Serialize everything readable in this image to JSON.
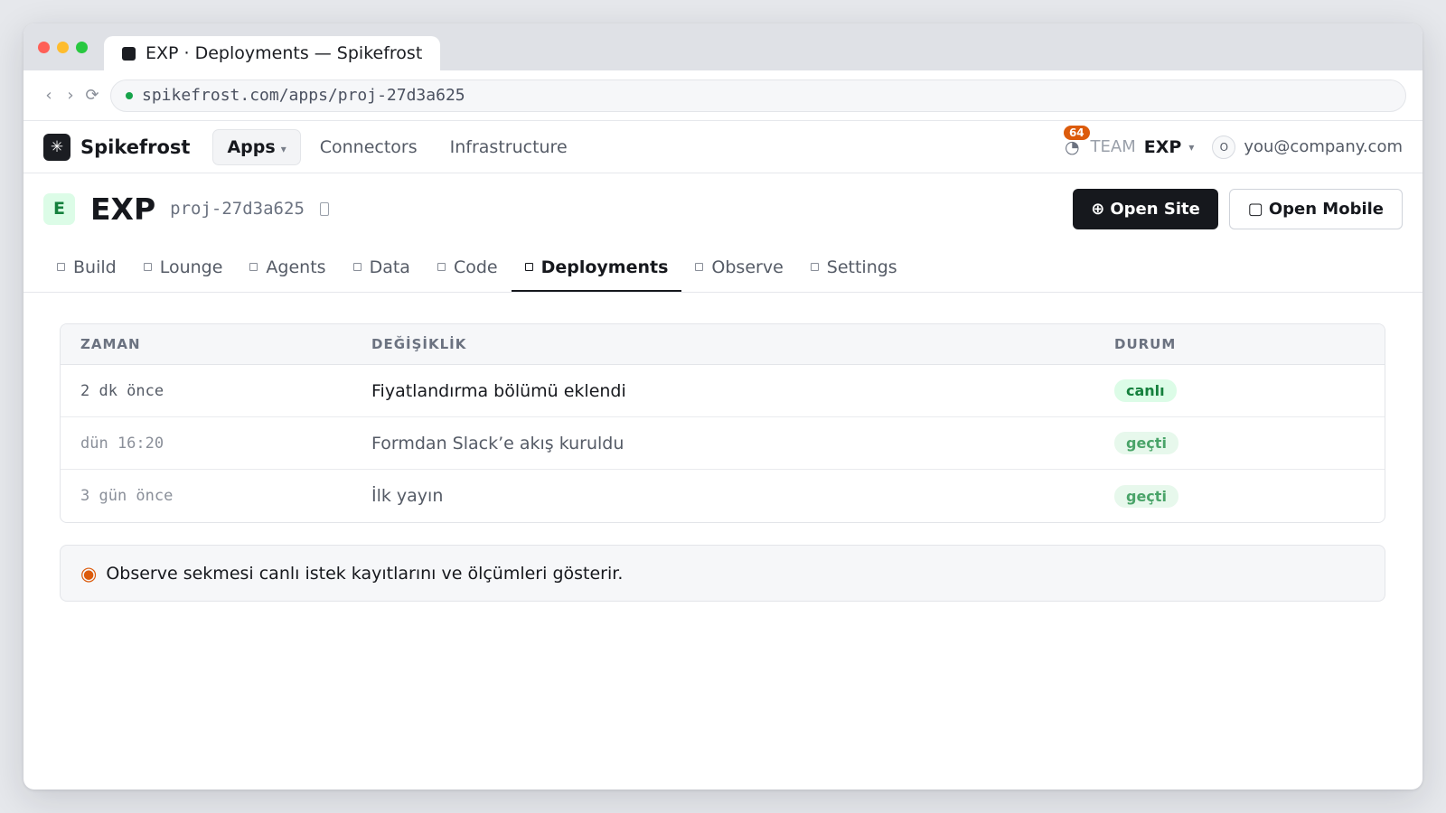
{
  "browser": {
    "tab_title": "EXP · Deployments — Spikefrost",
    "url": "spikefrost.com/apps/proj-27d3a625",
    "back_icon": "‹",
    "forward_icon": "›",
    "reload_icon": "⟳"
  },
  "topnav": {
    "brand_glyph": "✳",
    "brand_name": "Spikefrost",
    "links": [
      {
        "label": "Apps",
        "active": true
      },
      {
        "label": "Connectors",
        "active": false
      },
      {
        "label": "Infrastructure",
        "active": false
      }
    ],
    "caret": "▾",
    "notification_icon": "◔",
    "notification_count": "64",
    "team_label": "TEAM",
    "team_name": "EXP",
    "avatar_initial": "O",
    "user_email": "you@company.com"
  },
  "project": {
    "initial": "E",
    "name": "EXP",
    "id": "proj-27d3a625",
    "open_site_icon": "⊕",
    "open_site_label": "Open Site",
    "open_mobile_icon": "▢",
    "open_mobile_label": "Open Mobile"
  },
  "tabs": [
    {
      "label": "Build",
      "active": false
    },
    {
      "label": "Lounge",
      "active": false
    },
    {
      "label": "Agents",
      "active": false
    },
    {
      "label": "Data",
      "active": false
    },
    {
      "label": "Code",
      "active": false
    },
    {
      "label": "Deployments",
      "active": true
    },
    {
      "label": "Observe",
      "active": false
    },
    {
      "label": "Settings",
      "active": false
    }
  ],
  "deployments": {
    "columns": {
      "time": "ZAMAN",
      "change": "DEĞİŞİKLİK",
      "status": "DURUM"
    },
    "rows": [
      {
        "time": "2 dk önce",
        "change": "Fiyatlandırma bölümü eklendi",
        "status": "canlı"
      },
      {
        "time": "dün 16:20",
        "change": "Formdan Slack’e akış kuruldu",
        "status": "geçti"
      },
      {
        "time": "3 gün önce",
        "change": "İlk yayın",
        "status": "geçti"
      }
    ]
  },
  "note": {
    "icon": "◉",
    "text": "Observe sekmesi canlı istek kayıtlarını ve ölçümleri gösterir."
  },
  "colors": {
    "accent_dark": "#16181d",
    "status_live": "#15803d",
    "status_passed": "#4aa469",
    "notification": "#dc5b0c",
    "project_badge_bg": "#dcfce7"
  }
}
